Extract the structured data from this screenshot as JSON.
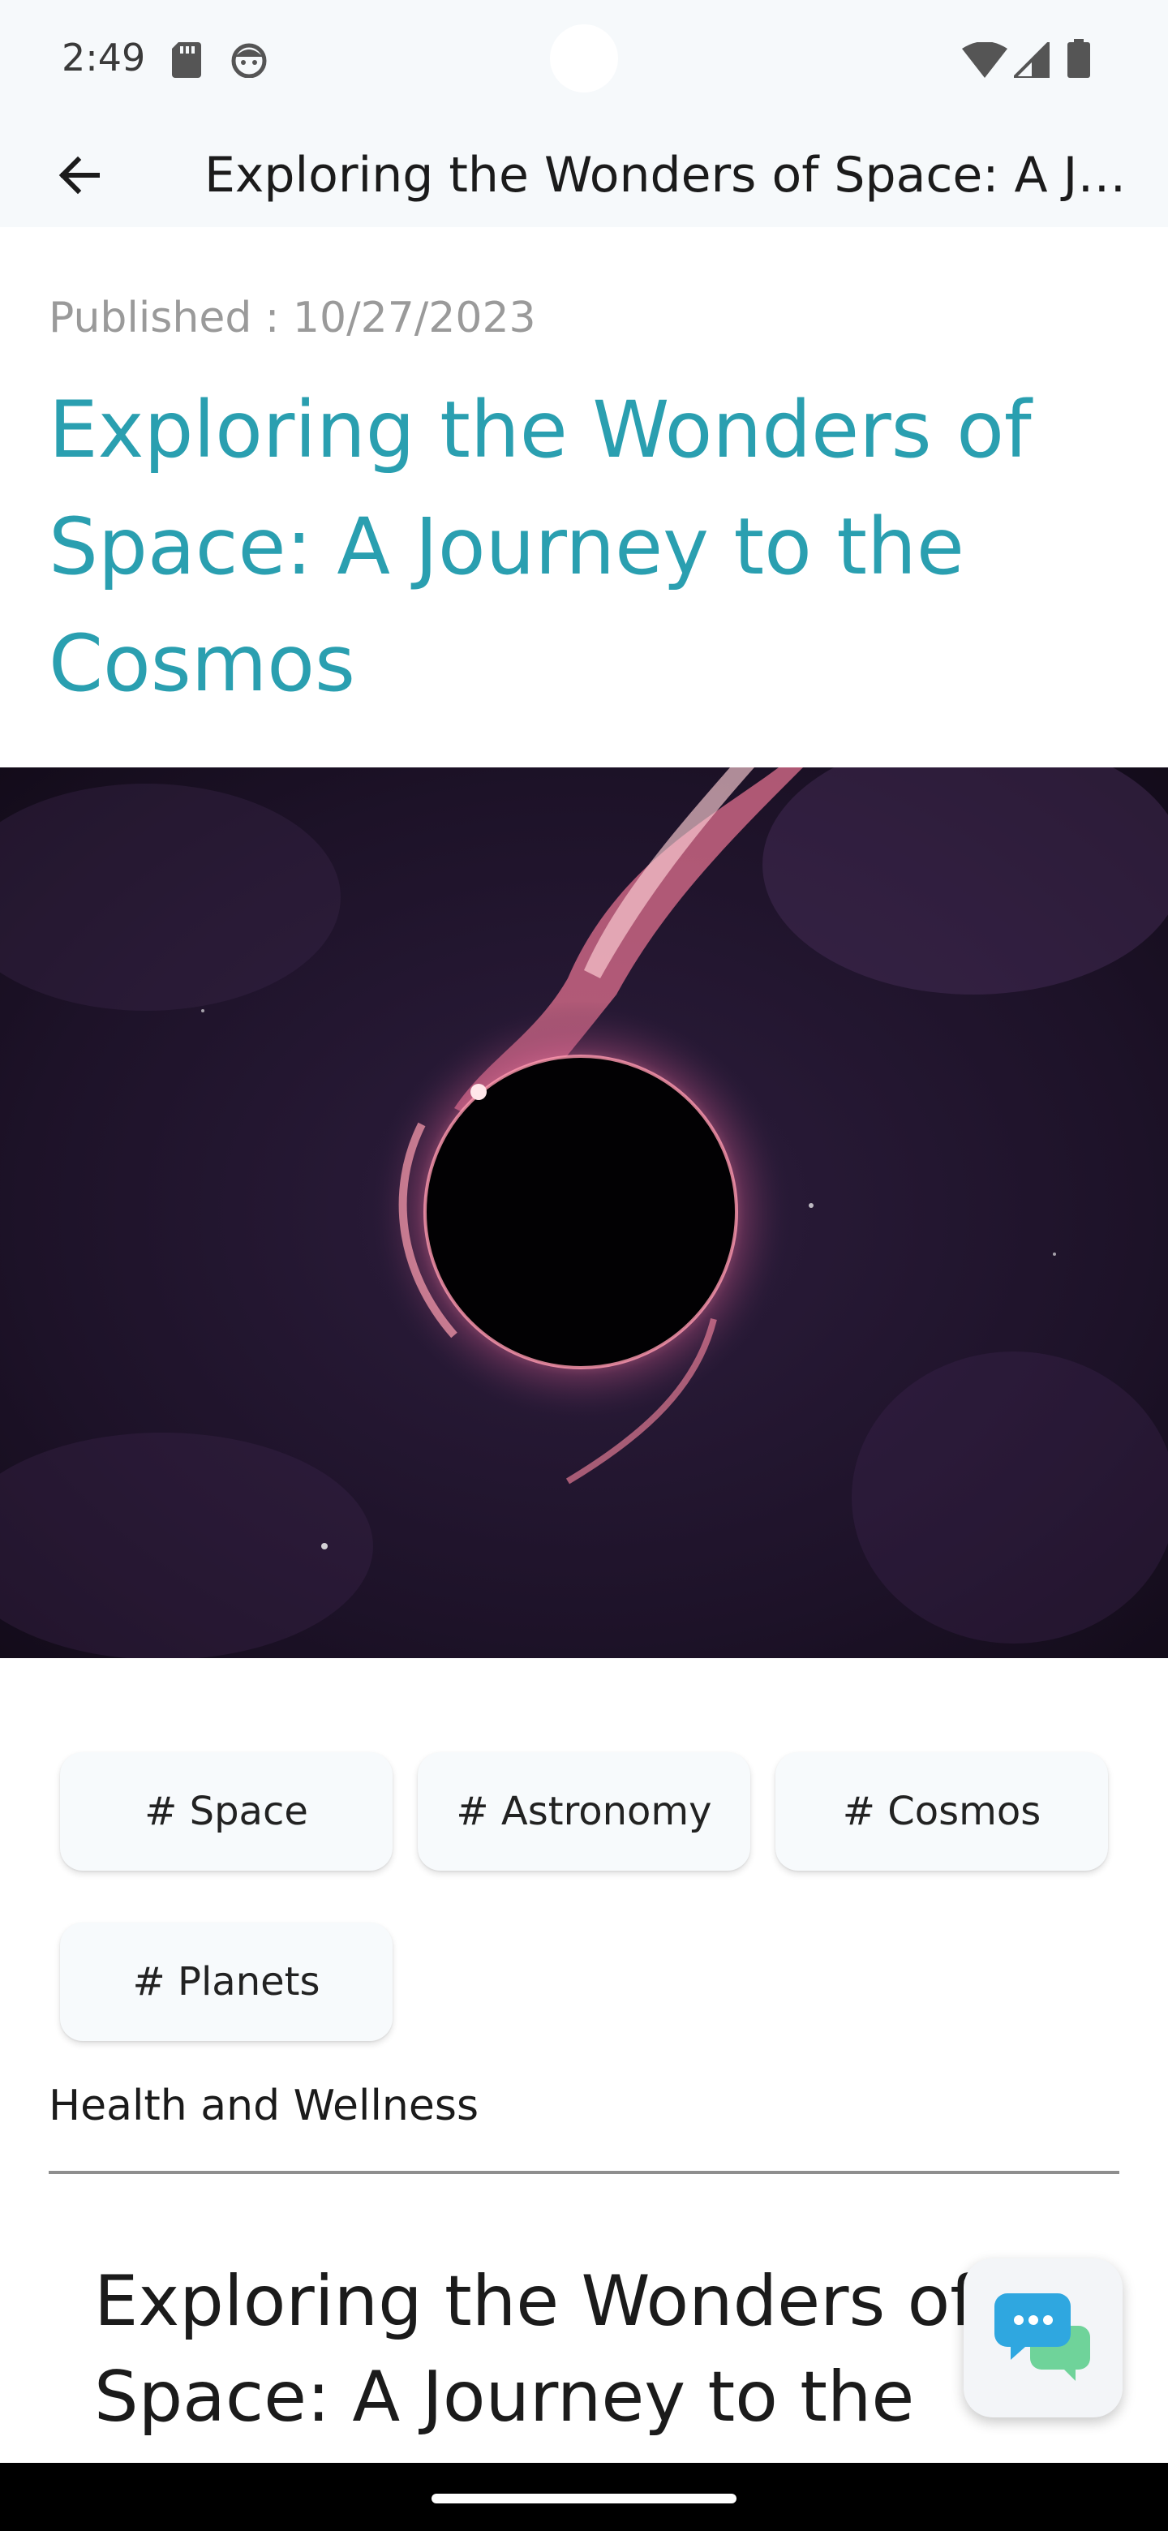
{
  "status_bar": {
    "time": "2:49",
    "icons": [
      "sd-card-icon",
      "face-icon",
      "wifi-icon",
      "signal-icon",
      "battery-icon"
    ]
  },
  "app_bar": {
    "back_icon": "arrow-back-icon",
    "title": "Exploring the Wonders of Space: A Journey to the Cosmos"
  },
  "article": {
    "published": "Published : 10/27/2023",
    "title": "Exploring the Wonders of Space: A Journey to the Cosmos",
    "hero_image": "black-hole-space-image",
    "tags": [
      "# Space",
      "# Astronomy",
      "# Cosmos",
      "# Planets"
    ],
    "category": "Health and Wellness",
    "body_heading": "Exploring the Wonders of Space: A Journey to the Cosmos"
  },
  "fab": {
    "icon": "chat-bubbles-icon"
  },
  "colors": {
    "accent": "#2a9fb0",
    "appbar_bg": "#f6f9fb",
    "tag_bg": "#f7fafc",
    "muted_text": "#9a9a9a"
  }
}
